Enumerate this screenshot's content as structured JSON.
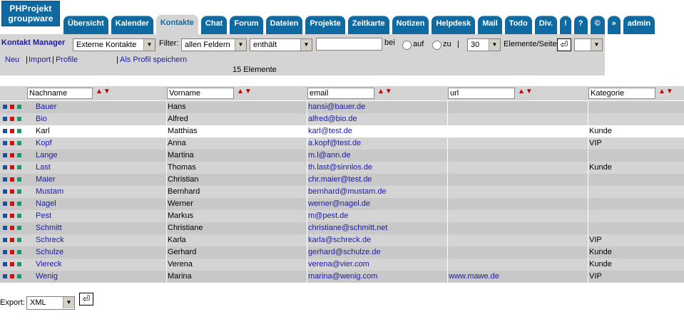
{
  "app": {
    "logo_line1": "PHProjekt",
    "logo_line2": "groupware"
  },
  "tabs": [
    {
      "label": "Übersicht",
      "active": false
    },
    {
      "label": "Kalender",
      "active": false
    },
    {
      "label": "Kontakte",
      "active": true
    },
    {
      "label": "Chat",
      "active": false
    },
    {
      "label": "Forum",
      "active": false
    },
    {
      "label": "Dateien",
      "active": false
    },
    {
      "label": "Projekte",
      "active": false
    },
    {
      "label": "Zeitkarte",
      "active": false
    },
    {
      "label": "Notizen",
      "active": false
    },
    {
      "label": "Helpdesk",
      "active": false
    },
    {
      "label": "Mail",
      "active": false
    },
    {
      "label": "Todo",
      "active": false
    },
    {
      "label": "Div.",
      "active": false
    },
    {
      "label": "!",
      "active": false
    },
    {
      "label": "?",
      "active": false
    },
    {
      "label": "©",
      "active": false
    },
    {
      "label": "»",
      "active": false
    },
    {
      "label": "admin",
      "active": false
    }
  ],
  "toolbar": {
    "title": "Kontakt Manager",
    "contact_type": "Externe Kontakte",
    "filter_label": "Filter:",
    "filter_field": "allen Feldern",
    "filter_op": "enthält",
    "filter_value": "",
    "bei_label": "bei",
    "auf_label": "auf",
    "zu_label": "zu",
    "pipe": "|",
    "per_page": "30",
    "per_page_label": "Elemente/Seite",
    "extra_select": ""
  },
  "actions": {
    "neu": "Neu",
    "import": "Import",
    "profile": "Profile",
    "save_profile": "Als Profil speichern",
    "count": "15 Elemente"
  },
  "columns": [
    "Nachname",
    "Vorname",
    "email",
    "url",
    "Kategorie"
  ],
  "colors": {
    "accent": "#0e6aa0",
    "sq_blue": "#1f4f9a",
    "sq_red": "#d01010",
    "sq_green": "#1a9a6a"
  },
  "rows": [
    {
      "nachname": "Bauer",
      "vorname": "Hans",
      "email": "hansi@bauer.de",
      "url": "",
      "kategorie": "",
      "highlight": false
    },
    {
      "nachname": "Bio",
      "vorname": "Alfred",
      "email": "alfred@bio.de",
      "url": "",
      "kategorie": "",
      "highlight": false
    },
    {
      "nachname": "Karl",
      "vorname": "Matthias",
      "email": "karl@test.de",
      "url": "",
      "kategorie": "Kunde",
      "highlight": true
    },
    {
      "nachname": "Kopf",
      "vorname": "Anna",
      "email": "a.kopf@test.de",
      "url": "",
      "kategorie": "VIP",
      "highlight": false
    },
    {
      "nachname": "Lange",
      "vorname": "Martina",
      "email": "m.l@ann.de",
      "url": "",
      "kategorie": "",
      "highlight": false
    },
    {
      "nachname": "Last",
      "vorname": "Thomas",
      "email": "th.last@sinnlos.de",
      "url": "",
      "kategorie": "Kunde",
      "highlight": false
    },
    {
      "nachname": "Maier",
      "vorname": "Christian",
      "email": "chr.maier@test.de",
      "url": "",
      "kategorie": "",
      "highlight": false
    },
    {
      "nachname": "Mustam",
      "vorname": "Bernhard",
      "email": "bernhard@mustam.de",
      "url": "",
      "kategorie": "",
      "highlight": false
    },
    {
      "nachname": "Nagel",
      "vorname": "Werner",
      "email": "werner@nagel.de",
      "url": "",
      "kategorie": "",
      "highlight": false
    },
    {
      "nachname": "Pest",
      "vorname": "Markus",
      "email": "m@pest.de",
      "url": "",
      "kategorie": "",
      "highlight": false
    },
    {
      "nachname": "Schmitt",
      "vorname": "Christiane",
      "email": "christiane@schmitt.net",
      "url": "",
      "kategorie": "",
      "highlight": false
    },
    {
      "nachname": "Schreck",
      "vorname": "Karla",
      "email": "karla@schreck.de",
      "url": "",
      "kategorie": "VIP",
      "highlight": false
    },
    {
      "nachname": "Schulze",
      "vorname": "Gerhard",
      "email": "gerhard@schulze.de",
      "url": "",
      "kategorie": "Kunde",
      "highlight": false
    },
    {
      "nachname": "Viereck",
      "vorname": "Verena",
      "email": "verena@vier.com",
      "url": "",
      "kategorie": "Kunde",
      "highlight": false
    },
    {
      "nachname": "Wenig",
      "vorname": "Marina",
      "email": "marina@wenig.com",
      "url": "www.mawe.de",
      "kategorie": "VIP",
      "highlight": false
    }
  ],
  "footer": {
    "export_label": "Export:",
    "export_format": "XML"
  }
}
